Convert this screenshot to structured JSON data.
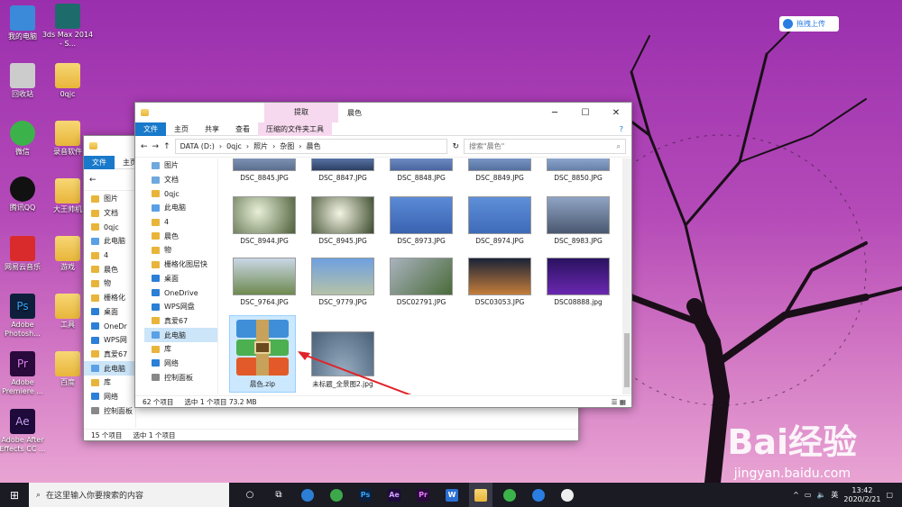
{
  "desktop": {
    "icons": [
      "我的电脑",
      "3ds Max 2014 - S...",
      "回收站",
      "0qjc",
      "微信",
      "录音软件",
      "腾讯QQ",
      "大王帅机",
      "网易云音乐",
      "游戏",
      "Adobe Photosh...",
      "工具",
      "Adobe Premiere ...",
      "百度",
      "Adobe After Effects CC ..."
    ],
    "upload_label": "拖拽上传",
    "watermark": "Bai经验",
    "watermark_url": "jingyan.baidu.com"
  },
  "front": {
    "ribbon_context": "提取",
    "title": "晨色",
    "tabs": [
      "文件",
      "主页",
      "共享",
      "查看"
    ],
    "context_tab": "压缩的文件夹工具",
    "path": [
      "DATA (D:)",
      "0qjc",
      "照片",
      "杂图",
      "晨色"
    ],
    "search_placeholder": "搜索\"晨色\"",
    "nav": [
      "图片",
      "文档",
      "0qjc",
      "此电脑",
      "4",
      "晨色",
      "物",
      "栅格化图层快",
      "桌面",
      "OneDrive",
      "WPS网盘",
      "真爱67",
      "此电脑",
      "库",
      "网络",
      "控制面板"
    ],
    "files": [
      "DSC_8845.JPG",
      "DSC_8847.JPG",
      "DSC_8848.JPG",
      "DSC_8849.JPG",
      "DSC_8850.JPG",
      "DSC_8944.JPG",
      "DSC_8945.JPG",
      "DSC_8973.JPG",
      "DSC_8974.JPG",
      "DSC_8983.JPG",
      "DSC_9764.JPG",
      "DSC_9779.JPG",
      "DSC02791.JPG",
      "DSC03053.JPG",
      "DSC08888.jpg",
      "晨色.zip",
      "未标题_全景图2.jpg"
    ],
    "status_count": "62 个项目",
    "status_sel": "选中 1 个项目  73.2 MB"
  },
  "back": {
    "tabs": [
      "文件",
      "主页"
    ],
    "nav": [
      "图片",
      "文档",
      "0qjc",
      "此电脑",
      "4",
      "晨色",
      "物",
      "栅格化",
      "桌面",
      "OneDr",
      "WPS网",
      "真爱67",
      "此电脑",
      "库",
      "网络",
      "控制面板"
    ],
    "status_count": "15 个项目",
    "status_sel": "选中 1 个项目"
  },
  "taskbar": {
    "search": "在这里输入你要搜索的内容",
    "ime": "英",
    "time": "13:42",
    "date": "2020/2/21",
    "apps": [
      "Ps",
      "Ae",
      "Pr",
      "W"
    ]
  }
}
